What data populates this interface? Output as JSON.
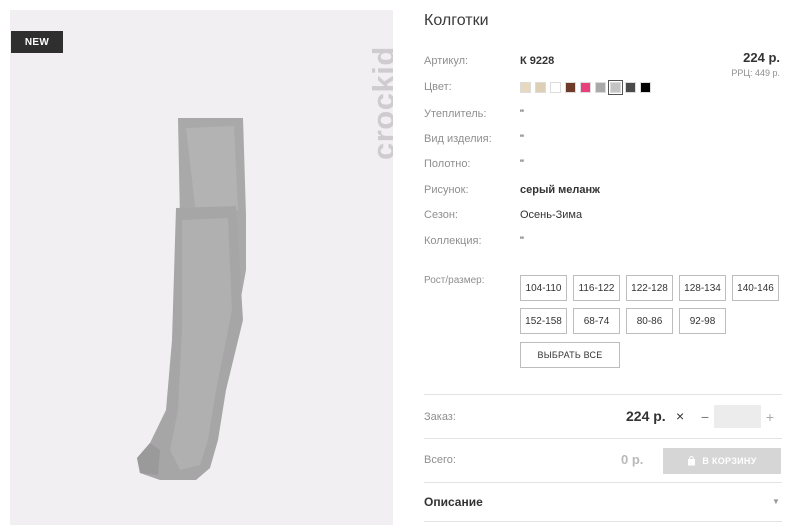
{
  "product": {
    "badge": "NEW",
    "brand": "crockid",
    "title": "Колготки",
    "price": "224 р.",
    "rrp": "РРЦ: 449 р."
  },
  "specs": [
    {
      "label": "Артикул:",
      "value": "К 9228"
    },
    {
      "label": "Цвет:",
      "value": ""
    },
    {
      "label": "Утеплитель:",
      "value": "\""
    },
    {
      "label": "Вид изделия:",
      "value": "\""
    },
    {
      "label": "Полотно:",
      "value": "\""
    },
    {
      "label": "Рисунок:",
      "value": "серый меланж"
    },
    {
      "label": "Сезон:",
      "value": "Осень-Зима"
    },
    {
      "label": "Коллекция:",
      "value": "\""
    }
  ],
  "colors": [
    "#e8d9be",
    "#ddd0b6",
    "#ffffff",
    "#6e3a2a",
    "#e8407c",
    "#a9a9a9",
    "#c4c4c4",
    "#4a4a4a",
    "#000000"
  ],
  "size_section": {
    "label": "Рост/размер:",
    "sizes": [
      "104-110",
      "116-122",
      "122-128",
      "128-134",
      "140-146",
      "152-158",
      "68-74",
      "80-86",
      "92-98"
    ],
    "select_all": "ВЫБРАТЬ ВСЕ"
  },
  "order": {
    "label": "Заказ:",
    "price": "224 р.",
    "times": "×",
    "minus": "−",
    "plus": "+",
    "quantity": ""
  },
  "total": {
    "label": "Всего:",
    "value": "0 р.",
    "cart_button": "В КОРЗИНУ"
  },
  "description": {
    "label": "Описание"
  }
}
